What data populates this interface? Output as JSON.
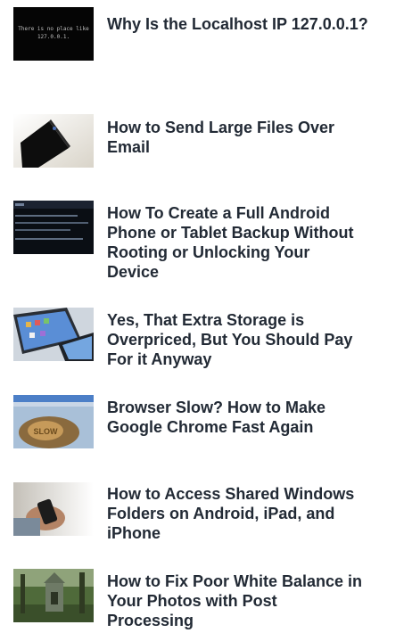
{
  "articles": [
    {
      "title": "Why Is the Localhost IP 127.0.0.1?",
      "thumb_icon": "terminal-localhost-thumbnail",
      "thumb_text_1": "There is no place like",
      "thumb_text_2": "127.0.0.1."
    },
    {
      "title": "How to Send Large Files Over\n Email",
      "thumb_icon": "envelope-thumbnail"
    },
    {
      "title": "How To Create a Full Android\n Phone or Tablet Backup Without\n Rooting or Unlocking Your\n Device",
      "thumb_icon": "android-terminal-thumbnail"
    },
    {
      "title": "Yes, That Extra Storage is\n Overpriced, But You Should Pay\n For it Anyway",
      "thumb_icon": "ipad-devices-thumbnail"
    },
    {
      "title": "Browser Slow? How to Make\n Google Chrome Fast Again",
      "thumb_icon": "slow-snail-browser-thumbnail"
    },
    {
      "title": "How to Access Shared Windows\n Folders on Android, iPad, and\n iPhone",
      "thumb_icon": "phone-in-hand-thumbnail"
    },
    {
      "title": "How to Fix Poor White Balance in\n Your Photos with Post\n Processing",
      "thumb_icon": "forest-ruin-photo-thumbnail"
    }
  ]
}
